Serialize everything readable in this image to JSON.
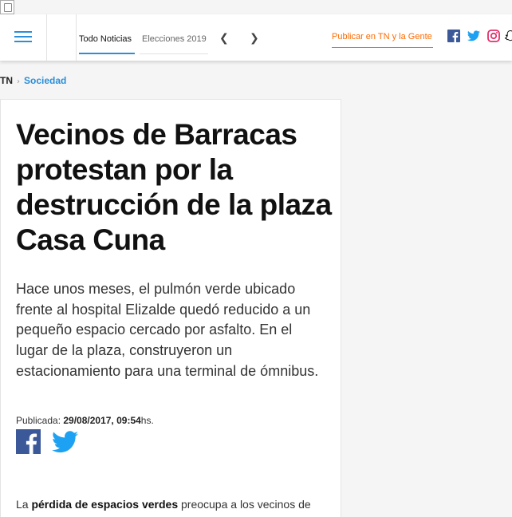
{
  "header": {
    "menu_icon": "hamburger-menu-icon",
    "tabs": [
      {
        "label": "Todo Noticias",
        "active": true
      },
      {
        "label": "Elecciones 2019",
        "active": false
      }
    ],
    "prev_icon": "chevron-left-icon",
    "next_icon": "chevron-right-icon",
    "publish_label": "Publicar en TN y la Gente",
    "social_icons": [
      "facebook-icon",
      "twitter-icon",
      "instagram-icon",
      "snapchat-icon"
    ]
  },
  "breadcrumb": {
    "home": "TN",
    "separator": "›",
    "section": "Sociedad"
  },
  "article": {
    "title": "Vecinos de Barracas protestan por la destrucción de la plaza Casa Cuna",
    "lead": "Hace unos meses, el pulmón verde ubicado frente al hospital Elizalde quedó reducido a un pequeño espacio cercado por asfalto. En el lugar de la plaza, construyeron un estacionamiento para una terminal de ómnibus.",
    "published_label": "Publicada: ",
    "published_date": "29/08/2017, 09:54",
    "published_suffix": "hs.",
    "share_icons": [
      "facebook-share-icon",
      "twitter-share-icon"
    ],
    "body_intro": "La ",
    "body_bold": "pérdida de espacios verdes",
    "body_rest": " preocupa a los vecinos de"
  },
  "colors": {
    "accent_blue": "#2b8ed8",
    "publish_orange": "#ff6a00",
    "facebook_blue": "#3b5998",
    "twitter_blue": "#1da1f2",
    "instagram_pink": "#e1306c"
  }
}
